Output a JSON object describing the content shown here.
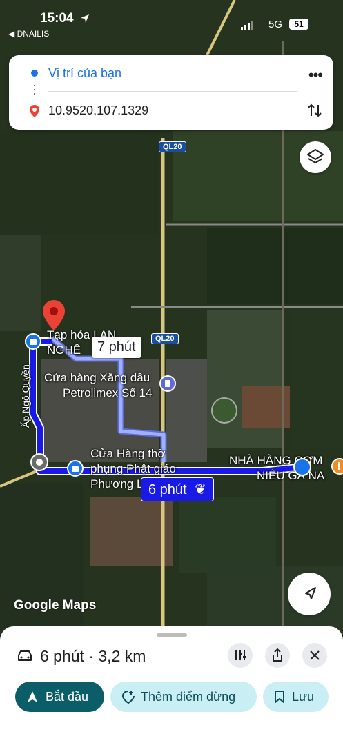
{
  "status_bar": {
    "time": "15:04",
    "back_app": "◀ DNAILIS",
    "network": "5G",
    "battery": "51"
  },
  "route_card": {
    "origin": "Vị trí của bạn",
    "destination": "10.9520,107.1329"
  },
  "map": {
    "road_shields": [
      "QL20",
      "QL20"
    ],
    "places": {
      "tap_hoa_line1": "Tạp hóa LAN",
      "tap_hoa_line2": "NGHỀ",
      "petrol_line1": "Cửa hàng Xăng dầu",
      "petrol_line2": "Petrolimex Số 14",
      "shop_line1": "Cửa Hàng thờ",
      "shop_line2": "phụng Phật giáo",
      "shop_line3": "Phương L",
      "restaurant_line1": "NHÀ HÀNG CƠM",
      "restaurant_line2": "NIÊU GÀ NA",
      "street": "Ấp Ngô Quyền"
    },
    "alt_route_time": "7 phút",
    "main_route_time": "6 phút",
    "watermark": "Google Maps"
  },
  "sheet": {
    "summary": "6 phút · 3,2 km",
    "start_label": "Bắt đầu",
    "add_stop_label": "Thêm điểm dừng",
    "save_label": "Lưu"
  },
  "colors": {
    "route_blue": "#1a1ae6",
    "alt_route": "#8ea0ff",
    "accent_teal": "#0b5e67",
    "chip_bg": "#c9eef3",
    "pin_red": "#ea4335"
  }
}
